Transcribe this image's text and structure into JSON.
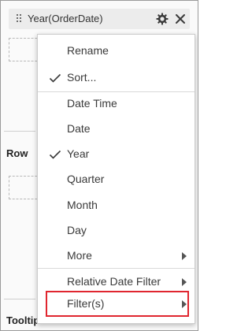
{
  "field": {
    "label": "Year(OrderDate)",
    "icons": {
      "settings": "gear-icon",
      "remove": "close-icon",
      "drag": "drag-handle-icon"
    }
  },
  "sections": {
    "row_label": "Row",
    "tooltip_label": "Tooltip"
  },
  "menu": {
    "items": [
      {
        "label": "Rename"
      },
      {
        "label": "Sort...",
        "checked": true
      },
      {
        "label": "Date Time"
      },
      {
        "label": "Date"
      },
      {
        "label": "Year",
        "checked": true
      },
      {
        "label": "Quarter"
      },
      {
        "label": "Month"
      },
      {
        "label": "Day"
      },
      {
        "label": "More",
        "submenu": true
      },
      {
        "label": "Relative Date Filter",
        "submenu": true
      },
      {
        "label": "Filter(s)",
        "submenu": true,
        "highlighted": true
      }
    ]
  },
  "colors": {
    "highlight_border": "#e0262f",
    "menu_text": "#3a3a3a"
  }
}
